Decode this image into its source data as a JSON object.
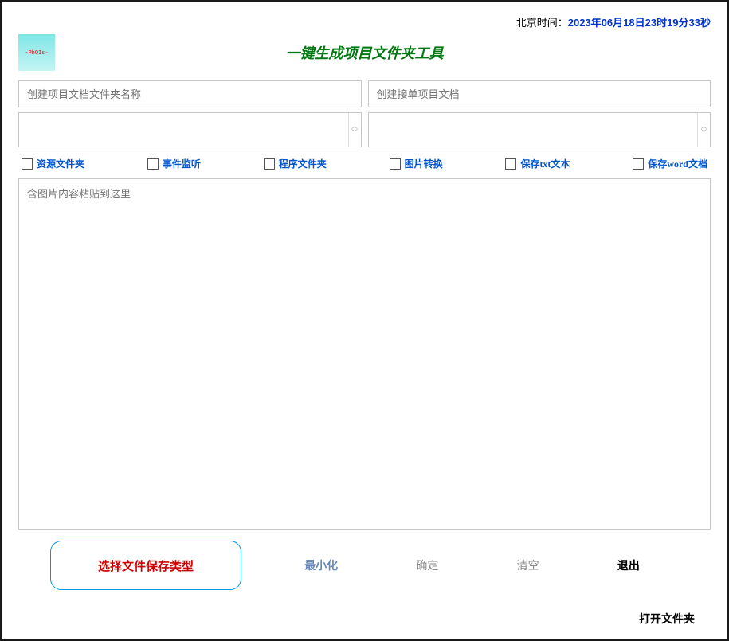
{
  "time": {
    "label": "北京时间：",
    "value": "2023年06月18日23时19分33秒"
  },
  "logo_text": "-PhQIs-",
  "app_title": "一键生成项目文件夹工具",
  "inputs": {
    "project_folder_name_placeholder": "创建项目文档文件夹名称",
    "project_folder_name_value": "",
    "receive_doc_placeholder": "创建接单项目文档",
    "receive_doc_value": ""
  },
  "selects": {
    "left_value": "",
    "right_value": ""
  },
  "checkboxes": [
    {
      "label": "资源文件夹"
    },
    {
      "label": "事件监听"
    },
    {
      "label": "程序文件夹"
    },
    {
      "label": "图片转换"
    },
    {
      "label": "保存txt文本"
    },
    {
      "label": "保存word文档"
    }
  ],
  "textarea": {
    "placeholder": "含图片内容粘贴到这里",
    "value": ""
  },
  "buttons": {
    "select_file_type": "选择文件保存类型",
    "minimize": "最小化",
    "confirm": "确定",
    "clear": "清空",
    "exit": "退出",
    "open_folder": "打开文件夹"
  }
}
